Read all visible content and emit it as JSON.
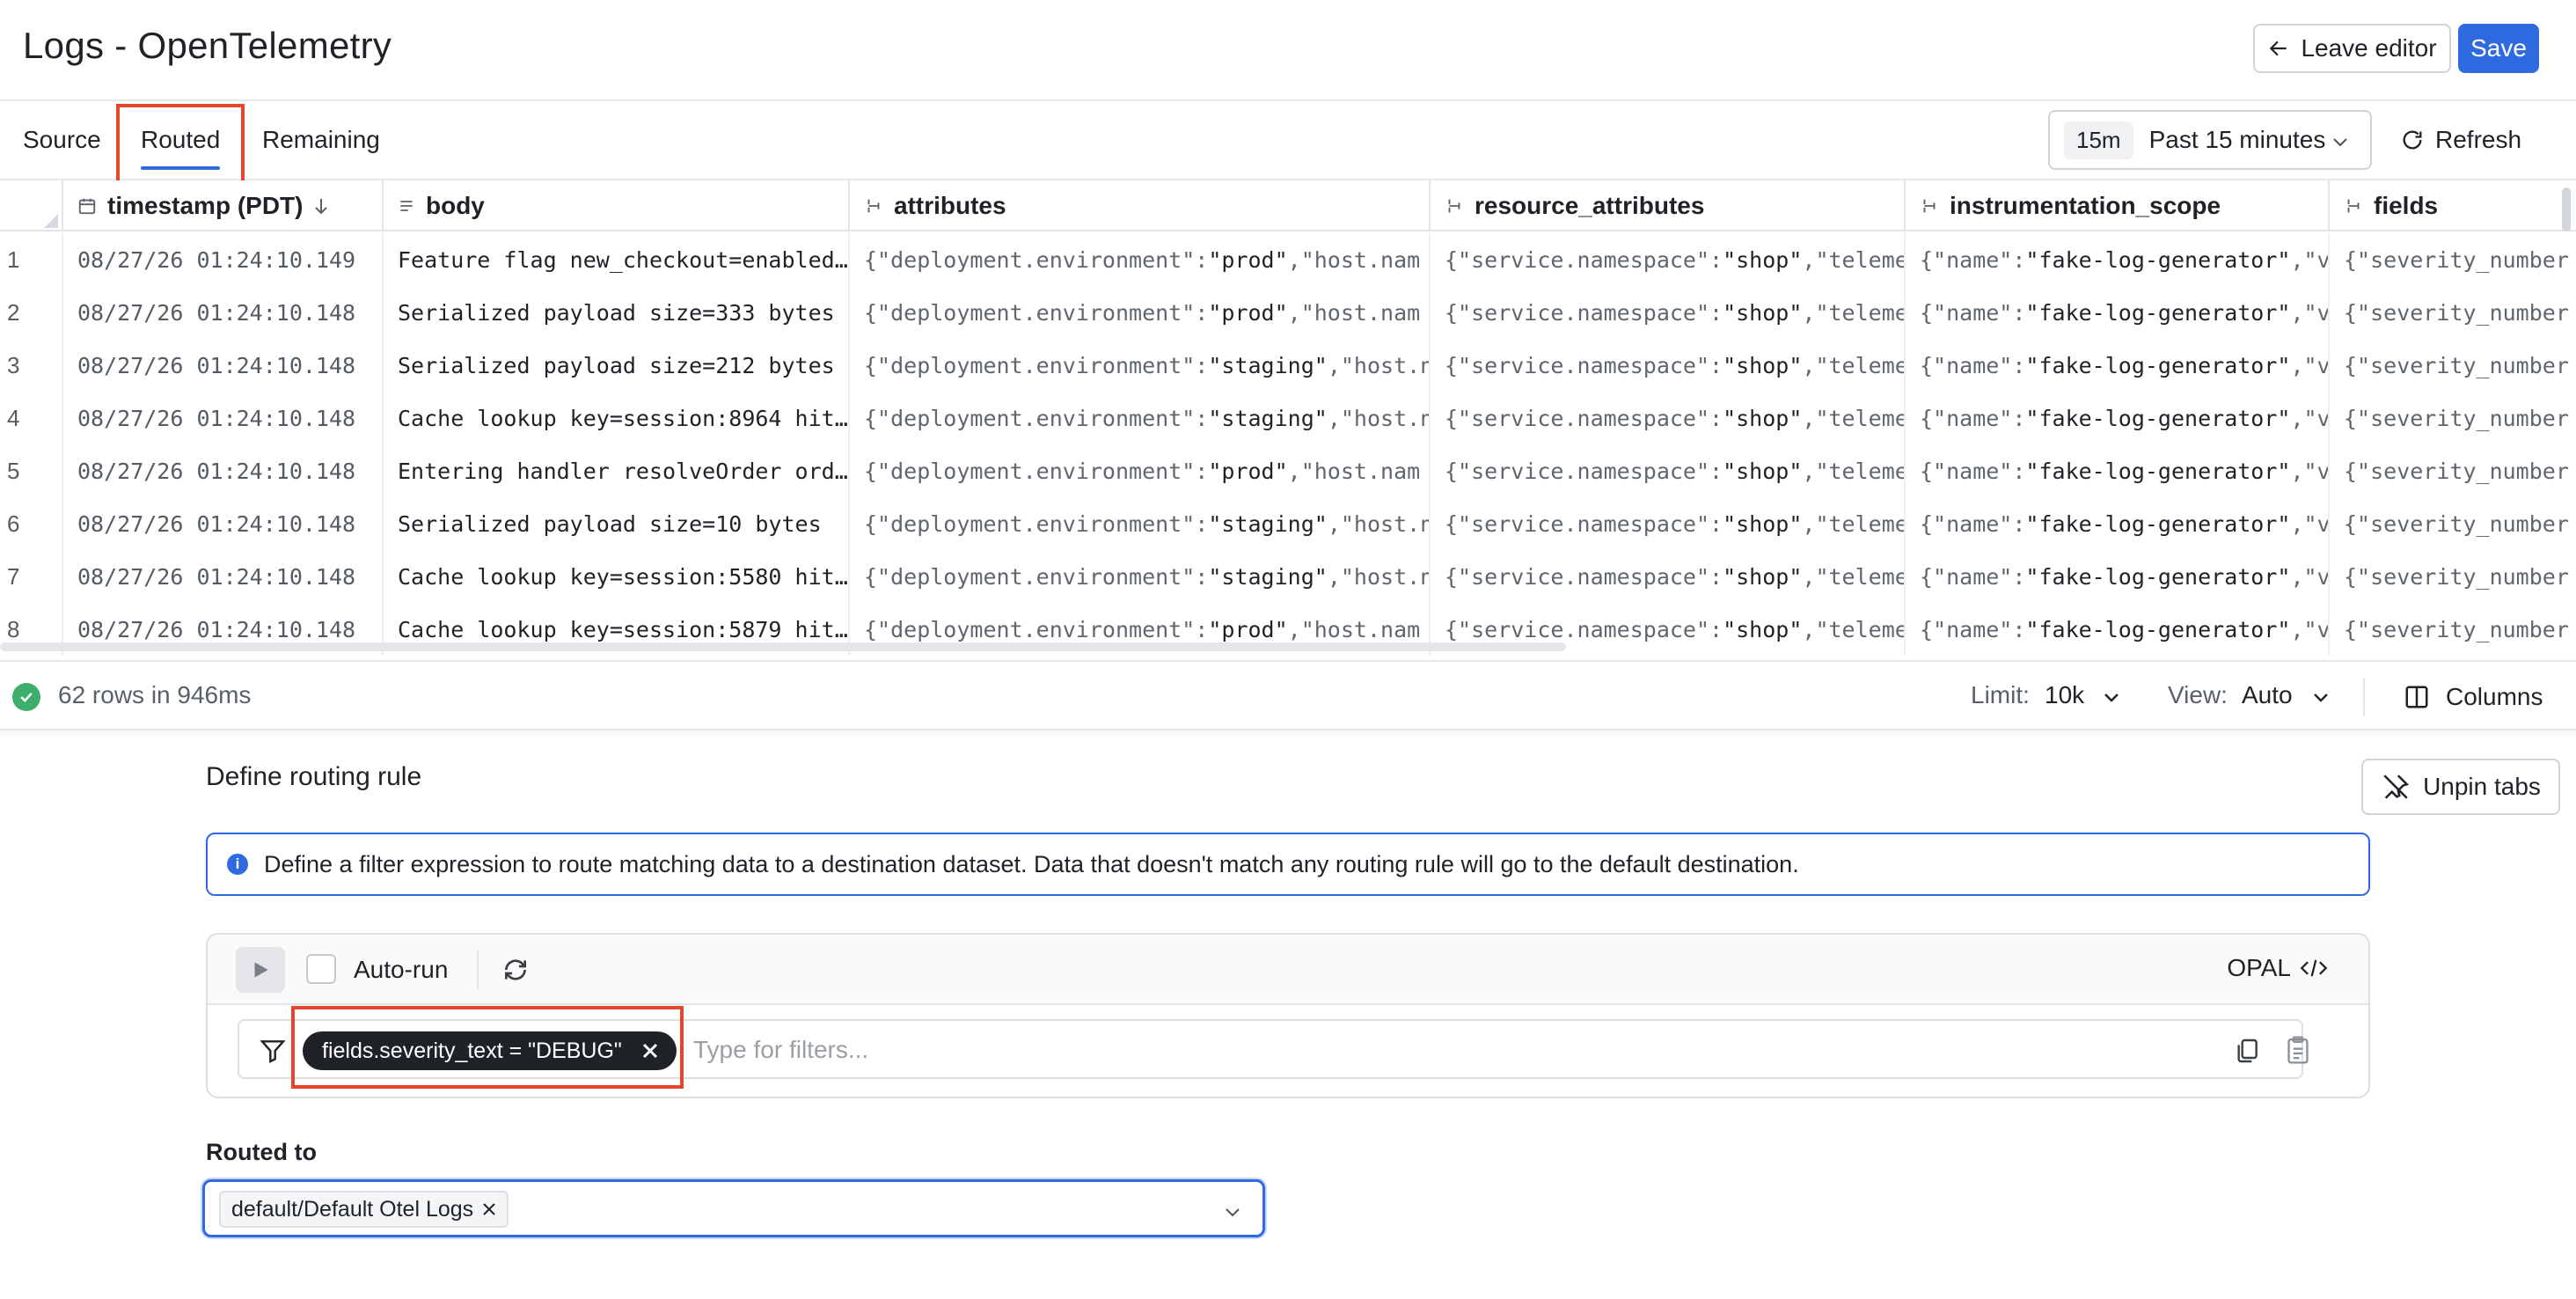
{
  "header": {
    "title": "Logs - OpenTelemetry",
    "leave_editor": "Leave editor",
    "save": "Save"
  },
  "tabs": [
    {
      "label": "Source"
    },
    {
      "label": "Routed",
      "active": true
    },
    {
      "label": "Remaining"
    }
  ],
  "time": {
    "chip": "15m",
    "label": "Past 15 minutes",
    "refresh": "Refresh"
  },
  "table": {
    "columns": [
      {
        "label": "timestamp (PDT)",
        "sort_icon": "arrow-down-icon"
      },
      {
        "label": "body"
      },
      {
        "label": "attributes"
      },
      {
        "label": "resource_attributes"
      },
      {
        "label": "instrumentation_scope"
      },
      {
        "label": "fields"
      }
    ],
    "rows": [
      {
        "n": "1",
        "ts": "08/27/26 01:24:10.149",
        "body": "Feature flag new_checkout=enabled…",
        "env": "prod",
        "attr_tail": ",\"host.nam"
      },
      {
        "n": "2",
        "ts": "08/27/26 01:24:10.148",
        "body": "Serialized payload size=333 bytes",
        "env": "prod",
        "attr_tail": ",\"host.nam"
      },
      {
        "n": "3",
        "ts": "08/27/26 01:24:10.148",
        "body": "Serialized payload size=212 bytes",
        "env": "staging",
        "attr_tail": ",\"host.n"
      },
      {
        "n": "4",
        "ts": "08/27/26 01:24:10.148",
        "body": "Cache lookup key=session:8964 hit…",
        "env": "staging",
        "attr_tail": ",\"host.n"
      },
      {
        "n": "5",
        "ts": "08/27/26 01:24:10.148",
        "body": "Entering handler resolveOrder ord…",
        "env": "prod",
        "attr_tail": ",\"host.nam"
      },
      {
        "n": "6",
        "ts": "08/27/26 01:24:10.148",
        "body": "Serialized payload size=10 bytes",
        "env": "staging",
        "attr_tail": ",\"host.n"
      },
      {
        "n": "7",
        "ts": "08/27/26 01:24:10.148",
        "body": "Cache lookup key=session:5580 hit…",
        "env": "staging",
        "attr_tail": ",\"host.n"
      },
      {
        "n": "8",
        "ts": "08/27/26 01:24:10.148",
        "body": "Cache lookup key=session:5879 hit…",
        "env": "prod",
        "attr_tail": ",\"host.nam"
      }
    ],
    "resource_text": {
      "key": "{\"service.namespace\":",
      "val": "\"shop\"",
      "tail": ",\"teleme"
    },
    "scope_text": {
      "key": "{\"name\":",
      "val": "\"fake-log-generator\"",
      "tail": ",\"v"
    },
    "fields_text": "{\"severity_number",
    "attr_key": "{\"deployment.environment\":"
  },
  "status": {
    "text": "62 rows in 946ms",
    "limit_label": "Limit:",
    "limit_value": "10k",
    "view_label": "View:",
    "view_value": "Auto",
    "columns": "Columns"
  },
  "routing": {
    "title": "Define routing rule",
    "unpin": "Unpin tabs",
    "info": "Define a filter expression to route matching data to a destination dataset. Data that doesn't match any routing rule will go to the default destination.",
    "autorun": "Auto-run",
    "language": "OPAL",
    "filter_chip": "fields.severity_text = \"DEBUG\"",
    "filter_placeholder": "Type for filters...",
    "routed_to_label": "Routed to",
    "destination": "default/Default Otel Logs"
  },
  "colors": {
    "accent": "#2f6ae0",
    "highlight": "#e8452e",
    "success": "#3fae6b"
  }
}
